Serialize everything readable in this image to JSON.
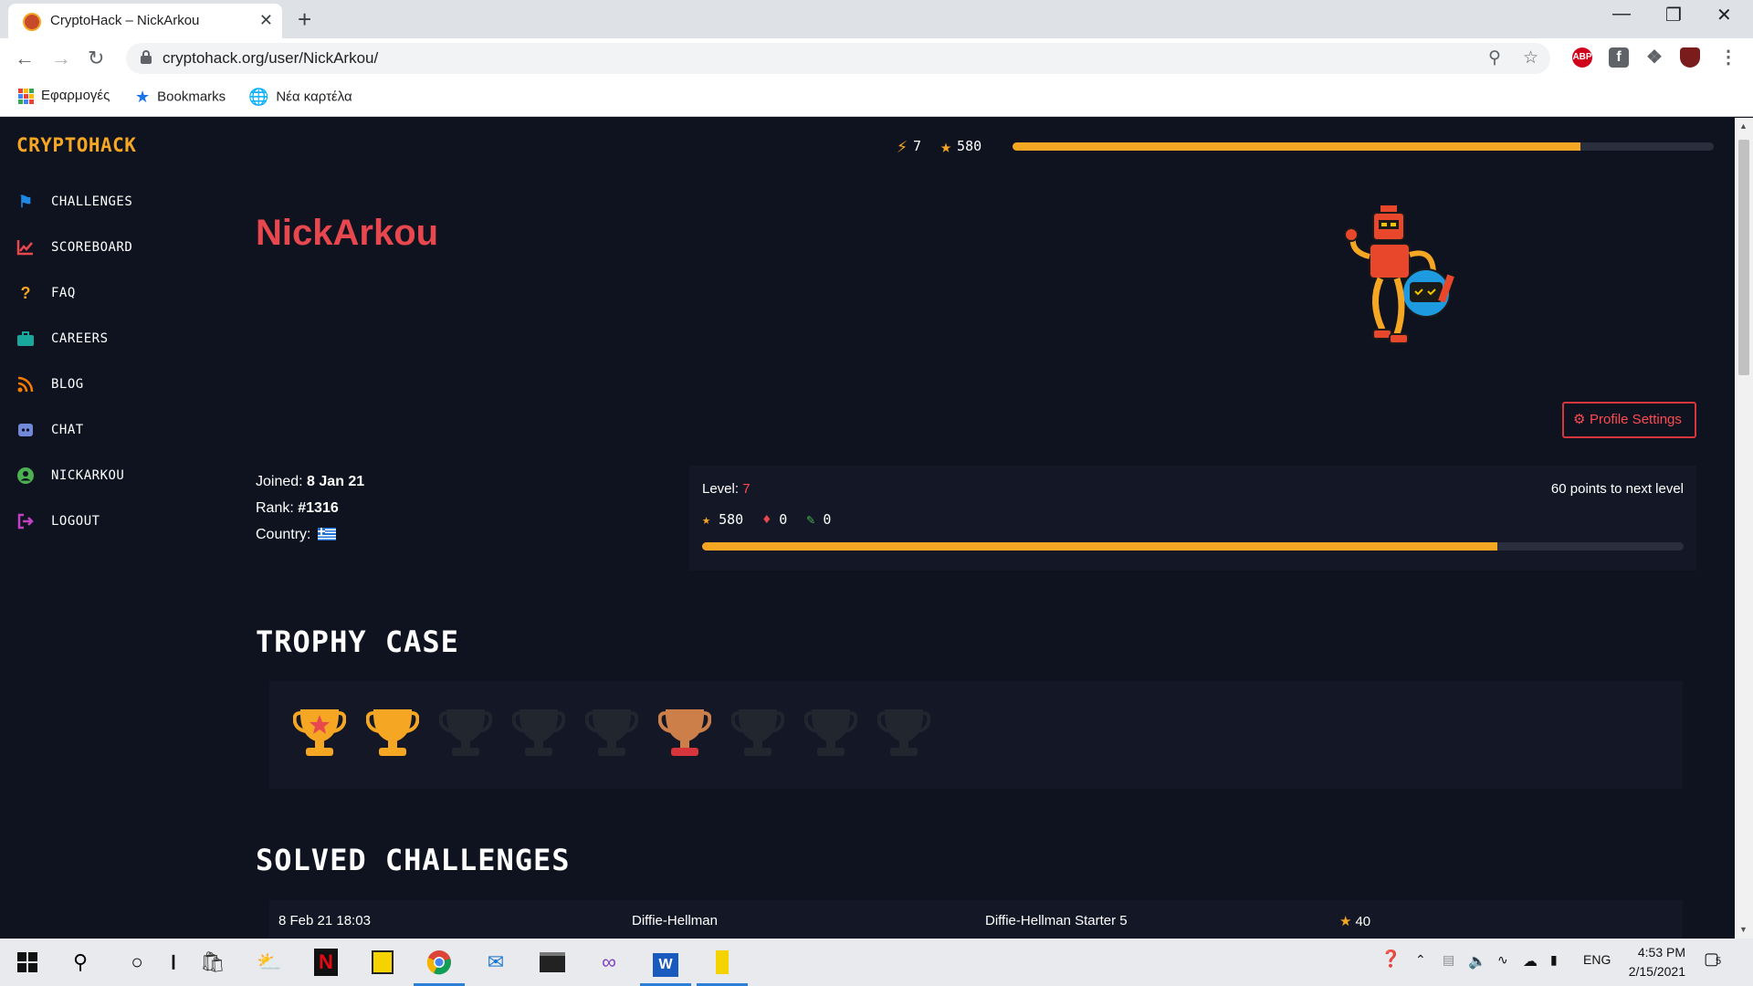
{
  "browser": {
    "tab_title": "CryptoHack – NickArkou",
    "tab_close": "✕",
    "new_tab": "+",
    "url": "cryptohack.org/user/NickArkou/",
    "bookmarks": [
      {
        "label": "Εφαρμογές"
      },
      {
        "label": "Bookmarks"
      },
      {
        "label": "Νέα καρτέλα"
      }
    ],
    "window_controls": {
      "minimize": "—",
      "maximize": "❐",
      "close": "✕"
    },
    "extensions": {
      "abp": "ABP",
      "facebook": "f"
    }
  },
  "site": {
    "brand": "CRYPTOHACK",
    "nav": [
      {
        "label": "CHALLENGES",
        "icon": "flag-icon",
        "color": "#1e88e5"
      },
      {
        "label": "SCOREBOARD",
        "icon": "chart-line-icon",
        "color": "#e8474e"
      },
      {
        "label": "FAQ",
        "icon": "question-icon",
        "color": "#f5a623"
      },
      {
        "label": "CAREERS",
        "icon": "briefcase-icon",
        "color": "#1aa89c"
      },
      {
        "label": "BLOG",
        "icon": "rss-icon",
        "color": "#f57c00"
      },
      {
        "label": "CHAT",
        "icon": "discord-icon",
        "color": "#7289da"
      },
      {
        "label": "NICKARKOU",
        "icon": "user-icon",
        "color": "#4caf50"
      },
      {
        "label": "LOGOUT",
        "icon": "sign-out-icon",
        "color": "#c042c0"
      }
    ],
    "top_stats": {
      "level": "7",
      "points": "580",
      "progress": 0.81
    }
  },
  "profile": {
    "username": "NickArkou",
    "settings_button": "Profile Settings",
    "joined_label": "Joined:",
    "joined": "8 Jan 21",
    "rank_label": "Rank:",
    "rank": "#1316",
    "country_label": "Country:",
    "country": "Greece",
    "level_label": "Level:",
    "level": "7",
    "next_level": "60 points to next level",
    "points": "580",
    "bloods": "0",
    "writeups": "0",
    "level_progress": 0.81
  },
  "trophy_case": {
    "title": "TROPHY CASE",
    "trophies": [
      {
        "state": "gold-star",
        "color": "#f5a623"
      },
      {
        "state": "gold",
        "color": "#f5a623"
      },
      {
        "state": "locked",
        "color": "#22262f"
      },
      {
        "state": "locked",
        "color": "#22262f"
      },
      {
        "state": "locked",
        "color": "#22262f"
      },
      {
        "state": "bronze",
        "color": "#cd7f4a"
      },
      {
        "state": "locked",
        "color": "#22262f"
      },
      {
        "state": "locked",
        "color": "#22262f"
      },
      {
        "state": "locked",
        "color": "#22262f"
      }
    ]
  },
  "solved": {
    "title": "SOLVED CHALLENGES",
    "rows": [
      {
        "date": "8 Feb 21 18:03",
        "category": "Diffie-Hellman",
        "name": "Diffie-Hellman Starter 5",
        "points": "40"
      }
    ]
  },
  "taskbar": {
    "lang": "ENG",
    "time": "4:53 PM",
    "date": "2/15/2021",
    "notifications": "5"
  }
}
